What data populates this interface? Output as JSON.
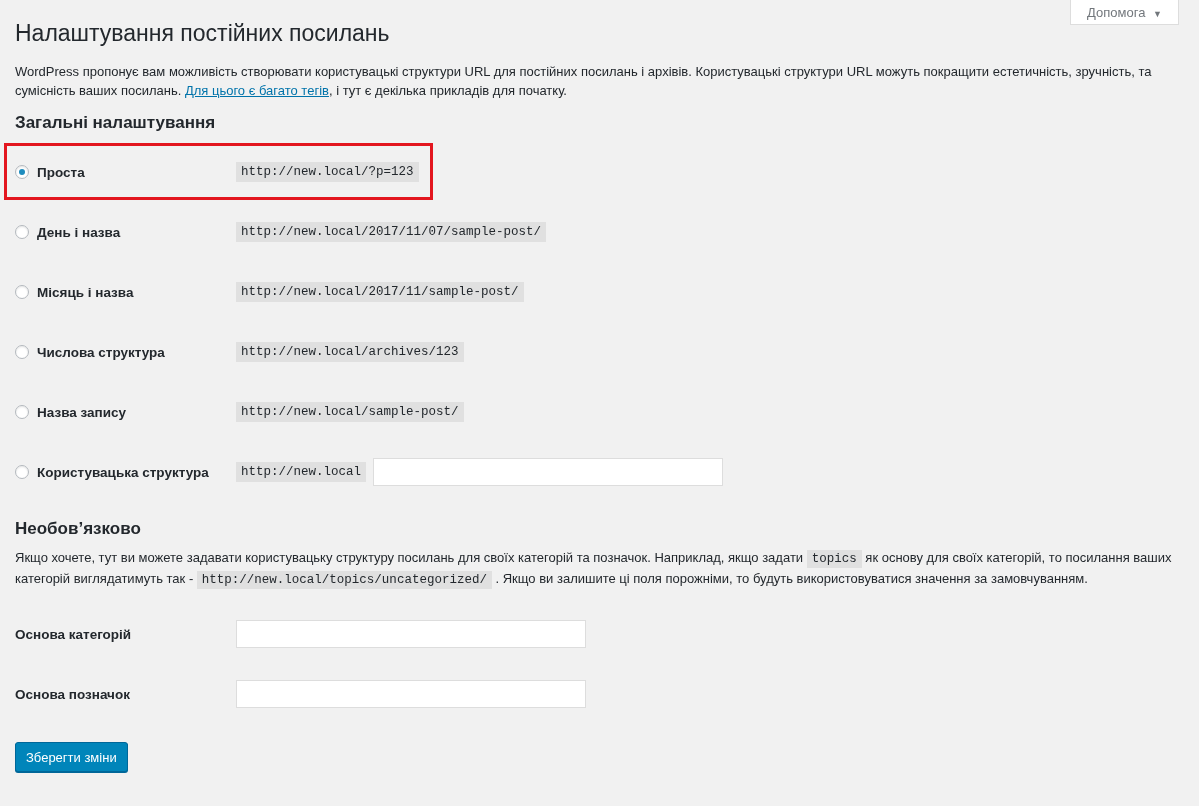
{
  "help_button": {
    "label": "Допомога",
    "caret": "▼"
  },
  "title": "Налаштування постійних посилань",
  "intro": [
    {
      "kind": "text",
      "text": "WordPress пропонує вам можливість створювати користувацькі структури URL для постійних посилань і архівів. Користувацькі структури URL можуть покращити естетичність, зручність, та сумісність ваших посилань. "
    },
    {
      "kind": "link",
      "text": "Для цього є багато тегів"
    },
    {
      "kind": "text",
      "text": ", і тут є декілька прикладів для початку."
    }
  ],
  "common_heading": "Загальні налаштування",
  "options": [
    {
      "label": "Проста",
      "example": "http://new.local/?p=123",
      "selected": true,
      "highlighted": true,
      "kind": "preset"
    },
    {
      "label": "День і назва",
      "example": "http://new.local/2017/11/07/sample-post/",
      "selected": false,
      "highlighted": false,
      "kind": "preset"
    },
    {
      "label": "Місяць і назва",
      "example": "http://new.local/2017/11/sample-post/",
      "selected": false,
      "highlighted": false,
      "kind": "preset"
    },
    {
      "label": "Числова структура",
      "example": "http://new.local/archives/123",
      "selected": false,
      "highlighted": false,
      "kind": "preset"
    },
    {
      "label": "Назва запису",
      "example": "http://new.local/sample-post/",
      "selected": false,
      "highlighted": false,
      "kind": "preset"
    },
    {
      "label": "Користувацька структура",
      "example": "http://new.local",
      "selected": false,
      "highlighted": false,
      "kind": "custom"
    }
  ],
  "optional_heading": "Необов’язково",
  "optional_text": [
    {
      "kind": "text",
      "text": "Якщо хочете, тут ви можете задавати користувацьку структуру посилань для своїх категорій та позначок. Наприклад, якщо задати "
    },
    {
      "kind": "code",
      "text": "topics"
    },
    {
      "kind": "text",
      "text": " як основу для своїх категорій, то посилання ваших категорій виглядатимуть так - "
    },
    {
      "kind": "code",
      "text": "http://new.local/topics/uncategorized/"
    },
    {
      "kind": "text",
      "text": " . Якщо ви залишите ці поля порожніми, то будуть використовуватися значення за замовчуванням."
    }
  ],
  "fields": [
    {
      "label": "Основа категорій"
    },
    {
      "label": "Основа позначок"
    }
  ],
  "save_button": "Зберегти зміни"
}
